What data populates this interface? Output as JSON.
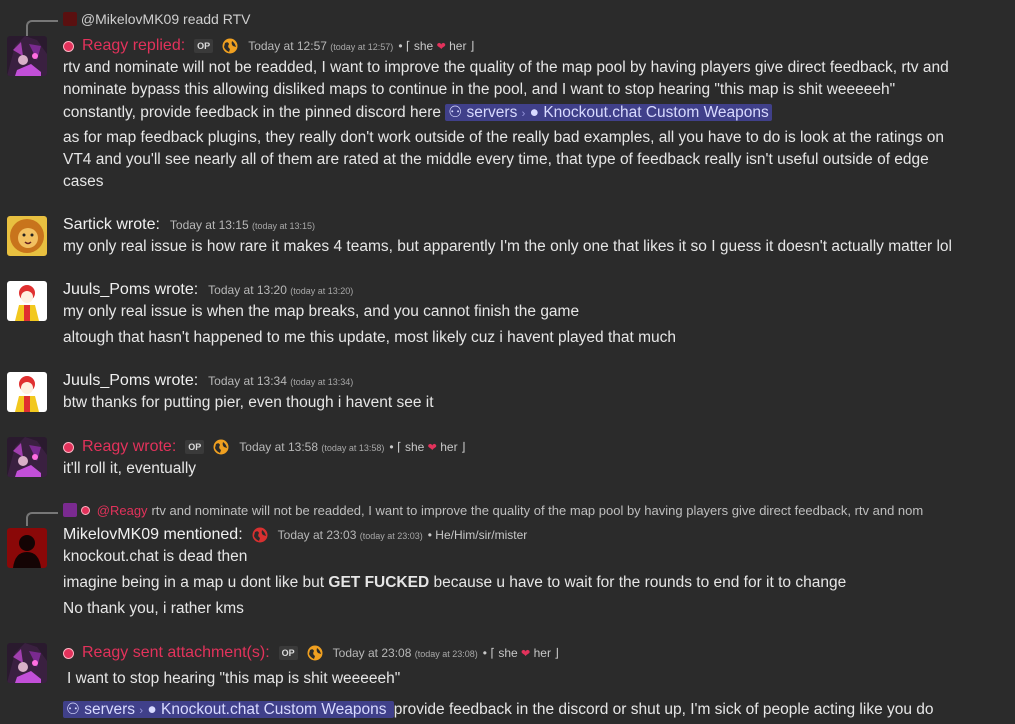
{
  "messages": [
    {
      "reply_to": {
        "user": "@MikelovMK09",
        "text": "readd RTV"
      },
      "author": "Reagy replied:",
      "op": "OP",
      "time": "Today at 12:57",
      "time_small": "(today at 12:57)",
      "pronoun_prefix": "• ⌈ she",
      "pronoun_suffix": "her ⌋",
      "body_1": "rtv and nominate will not be readded, I want to improve the quality of the map pool by having players give direct feedback, rtv and",
      "body_2": "nominate bypass this allowing disliked maps to continue in the pool, and I want to stop hearing \"this map is shit weeeeeh\"",
      "body_3": "constantly, provide feedback in the pinned discord here",
      "chip_a": "servers",
      "chip_b": "Knockout.chat Custom Weapons",
      "body_4": "as for map feedback plugins, they really don't work outside of the really bad examples, all you have to do is look at the ratings on",
      "body_5": "VT4 and you'll see nearly all of them are rated at the middle every time, that type of feedback really isn't useful outside of edge",
      "body_6": "cases"
    },
    {
      "author": "Sartick wrote:",
      "time": "Today at 13:15",
      "time_small": "(today at 13:15)",
      "body_1": "my only real issue is how rare it makes 4 teams, but apparently I'm the only one that likes it so I guess it doesn't actually matter lol"
    },
    {
      "author": "Juuls_Poms wrote:",
      "time": "Today at 13:20",
      "time_small": "(today at 13:20)",
      "body_1": "my only real issue is when the map breaks, and you cannot finish the game",
      "body_2": "altough that hasn't happened to me this update, most likely cuz i havent played that much"
    },
    {
      "author": "Juuls_Poms wrote:",
      "time": "Today at 13:34",
      "time_small": "(today at 13:34)",
      "body_1": "btw thanks for putting pier, even though i havent see it"
    },
    {
      "author": "Reagy wrote:",
      "op": "OP",
      "time": "Today at 13:58",
      "time_small": "(today at 13:58)",
      "pronoun_prefix": "• ⌈ she",
      "pronoun_suffix": "her ⌋",
      "body_1": "it'll roll it, eventually"
    },
    {
      "reply_to": {
        "user": "@Reagy",
        "text": "rtv and nominate will not be readded, I want to improve the quality of the map pool by having players give direct feedback, rtv and nom"
      },
      "author": "MikelovMK09 mentioned:",
      "time": "Today at 23:03",
      "time_small": "(today at 23:03)",
      "pronouns": "• He/Him/sir/mister",
      "body_1": "knockout.chat is dead then",
      "body_2_pre": "imagine being in a map u dont like but ",
      "body_2_bold": "GET FUCKED",
      "body_2_post": " because u have to wait for the rounds to end for it to change",
      "body_3": "No thank you, i rather kms"
    },
    {
      "author": "Reagy sent attachment(s):",
      "op": "OP",
      "time": "Today at 23:08",
      "time_small": "(today at 23:08)",
      "pronoun_prefix": "• ⌈ she",
      "pronoun_suffix": "her ⌋",
      "body_1": "I want to stop hearing \"this map is shit weeeeeh\"",
      "chip_a": "servers",
      "chip_b": "Knockout.chat Custom Weapons",
      "body_2": "provide feedback in the discord or shut up, I'm sick of people acting like you do"
    }
  ],
  "colors": {
    "background": "#2b2b2b",
    "op_name": "#e2325b",
    "chip": "#40408a"
  }
}
